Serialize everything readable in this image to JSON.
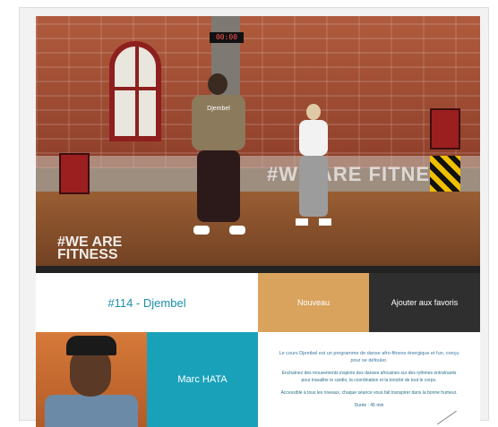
{
  "video": {
    "clock_text": "00:00",
    "wall_text": "#WE ARE FITNESS",
    "watermark_line1": "#WE ARE",
    "watermark_line2": "FITNESS",
    "shirt_text": "Djembel"
  },
  "session": {
    "title": "#114 - Djembel",
    "button_primary": "Nouveau",
    "button_secondary": "Ajouter aux favoris"
  },
  "coach": {
    "name": "Marc HATA"
  },
  "description": {
    "lead": "Le cours Djembel est un programme de danse afro-fitness énergique et fun, conçu pour se défouler.",
    "p1": "Enchaînez des mouvements inspirés des danses africaines sur des rythmes entraînants pour travailler le cardio, la coordination et la tonicité de tout le corps.",
    "p2": "Accessible à tous les niveaux, chaque séance vous fait transpirer dans la bonne humeur.",
    "footer": "Durée : 45 min"
  }
}
